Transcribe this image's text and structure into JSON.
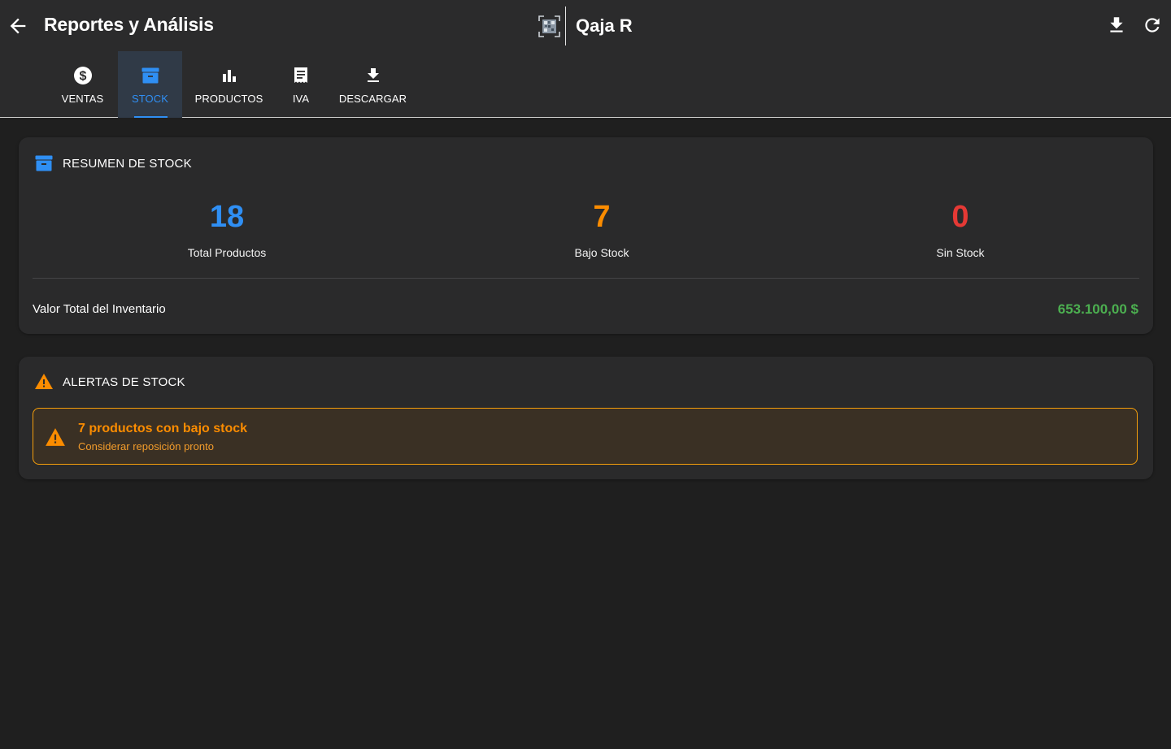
{
  "header": {
    "title": "Reportes y Análisis",
    "brand_name": "Qaja R"
  },
  "tabs": [
    {
      "label": "VENTAS",
      "icon": "dollar-circle-icon",
      "active": false
    },
    {
      "label": "STOCK",
      "icon": "archive-box-icon",
      "active": true
    },
    {
      "label": "PRODUCTOS",
      "icon": "bar-chart-icon",
      "active": false
    },
    {
      "label": "IVA",
      "icon": "receipt-icon",
      "active": false
    },
    {
      "label": "DESCARGAR",
      "icon": "download-icon",
      "active": false
    }
  ],
  "summary": {
    "title": "RESUMEN DE STOCK",
    "stats": [
      {
        "value": "18",
        "label": "Total Productos",
        "color": "#2f8ff4"
      },
      {
        "value": "7",
        "label": "Bajo Stock",
        "color": "#fb8c00"
      },
      {
        "value": "0",
        "label": "Sin Stock",
        "color": "#e53935"
      }
    ],
    "inventory_label": "Valor Total del Inventario",
    "inventory_value": "653.100,00 $"
  },
  "alerts": {
    "title": "ALERTAS DE STOCK",
    "items": [
      {
        "title": "7 productos con bajo stock",
        "subtitle": "Considerar reposición pronto"
      }
    ]
  },
  "colors": {
    "accent": "#2f8ff4",
    "warning": "#fb8c00",
    "danger": "#e53935",
    "success": "#4caf50"
  }
}
